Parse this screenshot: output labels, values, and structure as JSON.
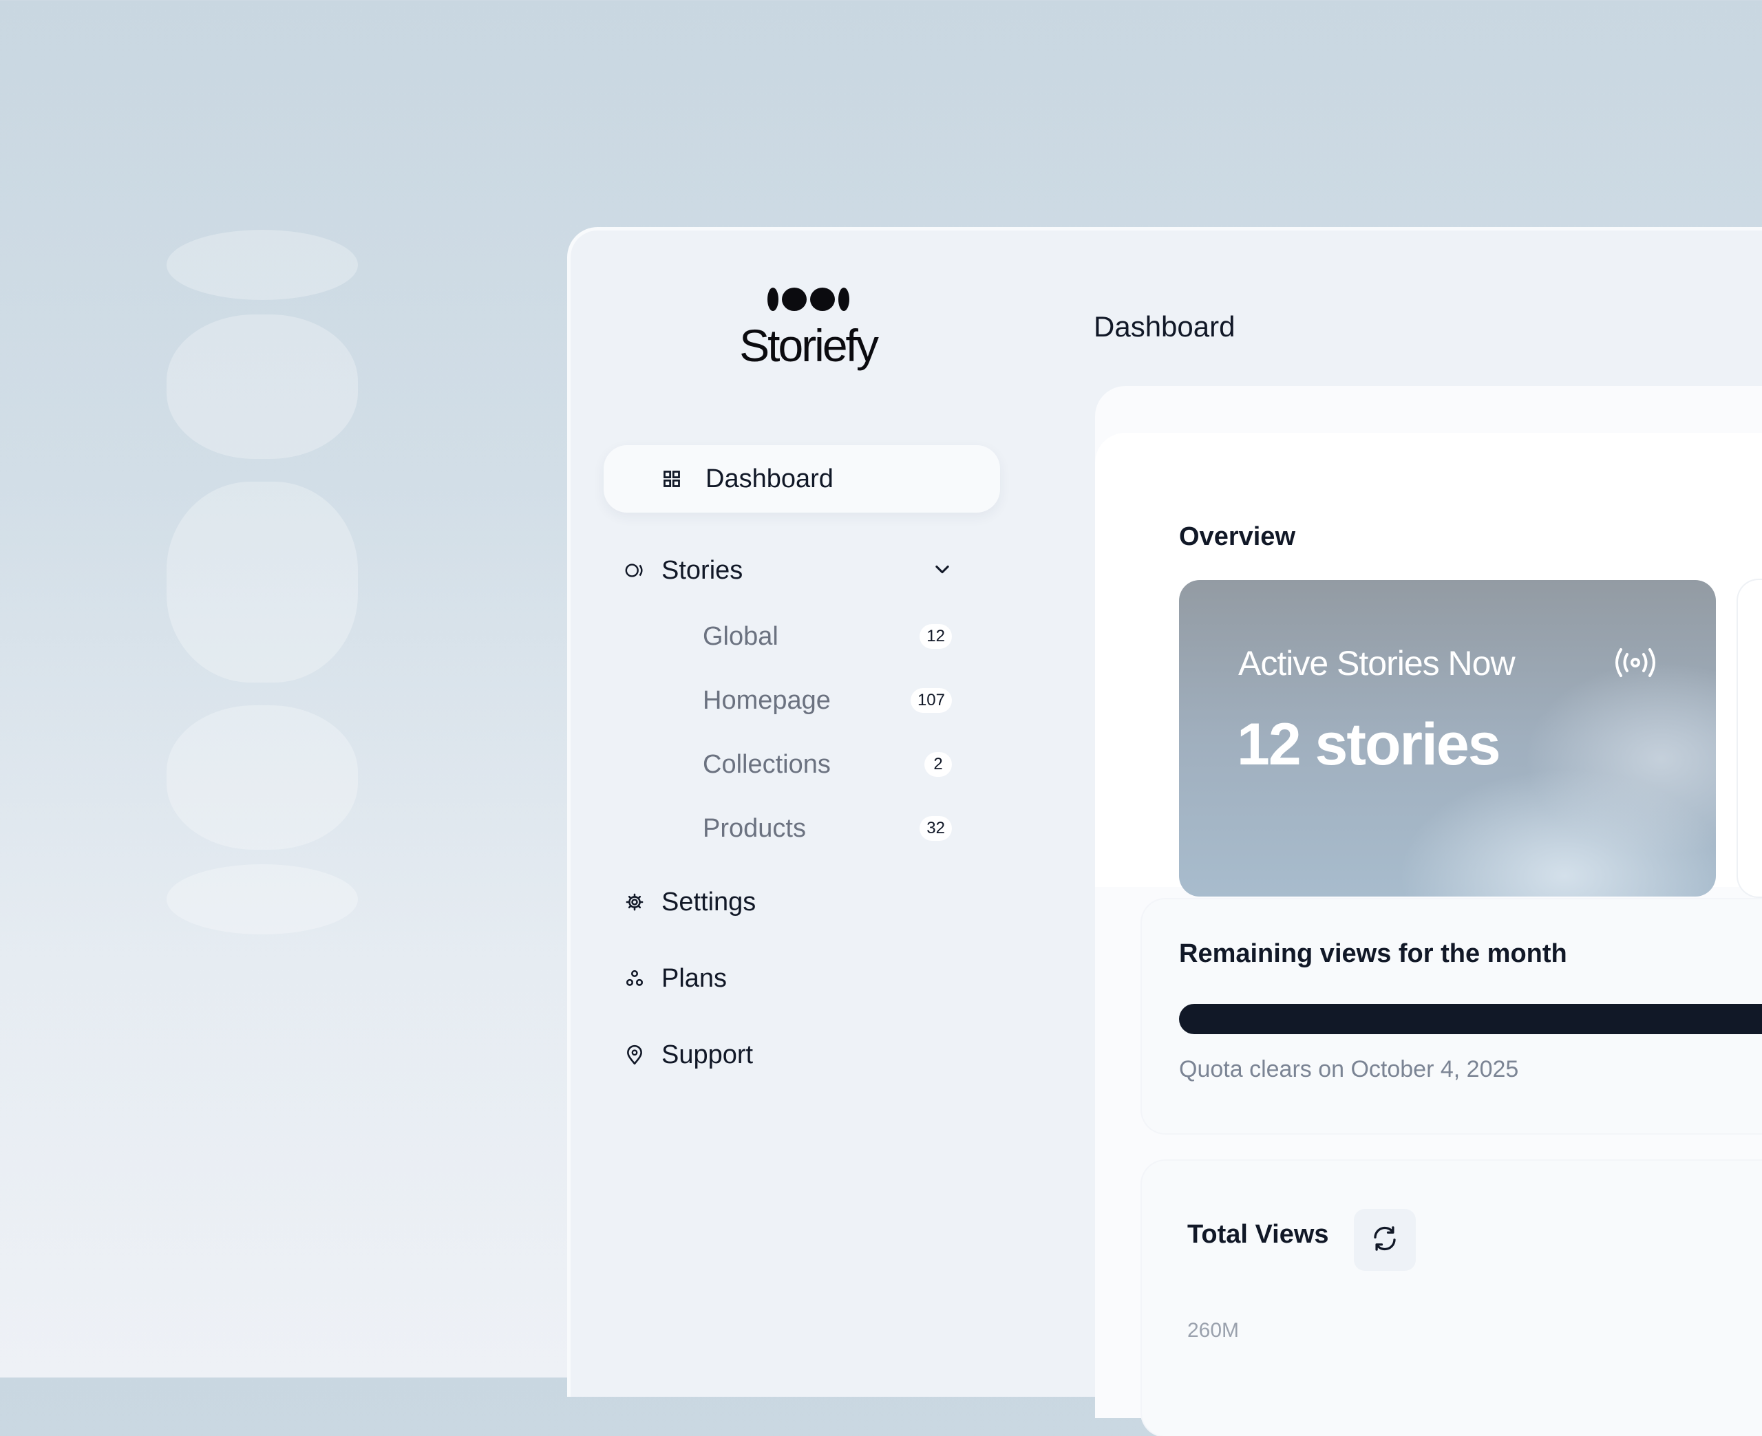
{
  "brand": {
    "name": "Storiefy",
    "icon": "logo-mark"
  },
  "sidebar": {
    "active": {
      "label": "Dashboard",
      "icon": "grid-icon"
    },
    "stories": {
      "label": "Stories",
      "icon": "stories-icon",
      "items": [
        {
          "label": "Global",
          "count": "12"
        },
        {
          "label": "Homepage",
          "count": "107"
        },
        {
          "label": "Collections",
          "count": "2"
        },
        {
          "label": "Products",
          "count": "32"
        }
      ]
    },
    "items": [
      {
        "label": "Settings",
        "icon": "gear-icon"
      },
      {
        "label": "Plans",
        "icon": "plans-icon"
      },
      {
        "label": "Support",
        "icon": "location-pin-icon"
      }
    ]
  },
  "main": {
    "title": "Dashboard",
    "overview": {
      "title": "Overview",
      "active_stories": {
        "label": "Active Stories Now",
        "value": "12 stories",
        "icon": "live-broadcast-icon"
      }
    },
    "views": {
      "title": "Remaining views for the month",
      "quota_text": "Quota clears on October 4, 2025"
    },
    "total": {
      "title": "Total Views",
      "refresh_icon": "refresh-icon",
      "axis_top": "260M"
    }
  },
  "colors": {
    "text": "#111827",
    "muted": "#6b7280",
    "progress": "#111827"
  }
}
